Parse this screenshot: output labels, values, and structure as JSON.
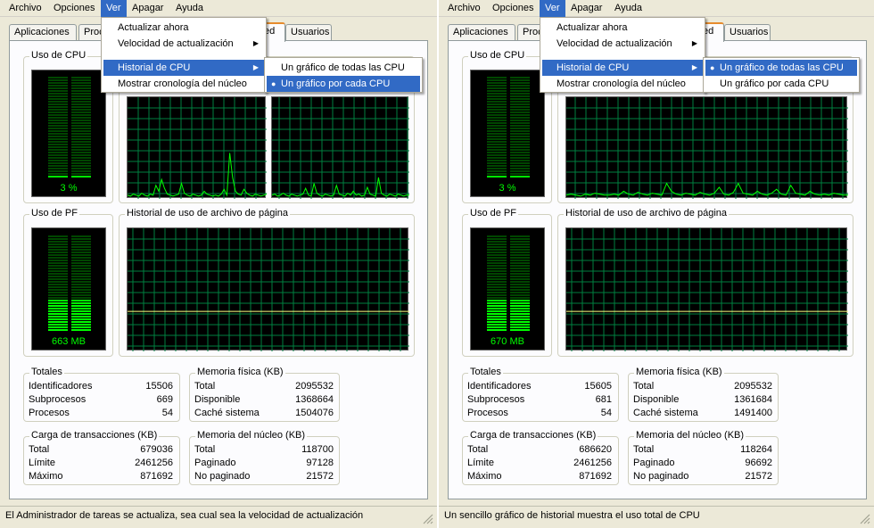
{
  "menubar": [
    "Archivo",
    "Opciones",
    "Ver",
    "Apagar",
    "Ayuda"
  ],
  "tabs": [
    "Aplicaciones",
    "Proc",
    "ed",
    "Usuarios"
  ],
  "view_menu": {
    "items": [
      "Actualizar ahora",
      "Velocidad de actualización",
      "Historial de CPU",
      "Mostrar cronología del núcleo"
    ]
  },
  "cpu_history_submenu": [
    "Un gráfico de todas las CPU",
    "Un gráfico por cada CPU"
  ],
  "labels": {
    "cpu_usage": "Uso de CPU",
    "pf_usage": "Uso de PF",
    "pagefile_history": "Historial de uso de archivo de página",
    "totals": "Totales",
    "physical_memory": "Memoria física (KB)",
    "commit_charge": "Carga de transacciones (KB)",
    "kernel_memory": "Memoria del núcleo (KB)",
    "handles": "Identificadores",
    "threads": "Subprocesos",
    "processes": "Procesos",
    "total": "Total",
    "available": "Disponible",
    "system_cache": "Caché sistema",
    "limit": "Límite",
    "peak": "Máximo",
    "paged": "Paginado",
    "nonpaged": "No paginado"
  },
  "left": {
    "selected_submenu_item": 1,
    "cpu_percent_text": "3 %",
    "cpu_percent": 3,
    "pf_text": "663 MB",
    "pf_fraction": 0.32,
    "totals": {
      "handles": "15506",
      "threads": "669",
      "processes": "54"
    },
    "physical": {
      "total": "2095532",
      "available": "1368664",
      "system_cache": "1504076"
    },
    "commit": {
      "total": "679036",
      "limit": "2461256",
      "peak": "871692"
    },
    "kernel": {
      "total": "118700",
      "paged": "97128",
      "nonpaged": "21572"
    },
    "status": "El Administrador de tareas se actualiza, sea cual sea la velocidad de actualización"
  },
  "right": {
    "selected_submenu_item": 0,
    "cpu_percent_text": "3 %",
    "cpu_percent": 3,
    "pf_text": "670 MB",
    "pf_fraction": 0.32,
    "totals": {
      "handles": "15605",
      "threads": "681",
      "processes": "54"
    },
    "physical": {
      "total": "2095532",
      "available": "1361684",
      "system_cache": "1491400"
    },
    "commit": {
      "total": "686620",
      "limit": "2461256",
      "peak": "871692"
    },
    "kernel": {
      "total": "118264",
      "paged": "96692",
      "nonpaged": "21572"
    },
    "status": "Un sencillo gráfico de historial muestra el uso total de CPU"
  },
  "colors": {
    "graph_bg": "#000000",
    "grid": "#008040",
    "cpu_line": "#00ff00",
    "pf_line": "#ffff80",
    "highlight": "#316ac5"
  },
  "graph_series": {
    "cpu_core0": [
      2,
      1,
      3,
      2,
      1,
      4,
      2,
      1,
      3,
      2,
      12,
      6,
      18,
      9,
      3,
      2,
      1,
      2,
      3,
      14,
      4,
      2,
      1,
      3,
      2,
      1,
      2,
      6,
      3,
      2,
      1,
      2,
      1,
      3,
      8,
      2,
      45,
      20,
      6,
      3,
      2,
      8,
      4,
      2,
      1,
      3,
      2,
      1,
      2,
      3
    ],
    "cpu_core1": [
      2,
      3,
      1,
      2,
      4,
      2,
      1,
      3,
      2,
      1,
      2,
      3,
      9,
      2,
      1,
      14,
      4,
      2,
      1,
      3,
      2,
      1,
      2,
      12,
      3,
      2,
      1,
      4,
      2,
      6,
      2,
      3,
      1,
      2,
      10,
      3,
      2,
      1,
      20,
      4,
      2,
      1,
      3,
      2,
      1,
      3,
      2,
      1,
      2,
      2
    ],
    "cpu_total": [
      2,
      3,
      2,
      1,
      3,
      2,
      4,
      3,
      2,
      2,
      3,
      2,
      6,
      3,
      2,
      5,
      3,
      2,
      4,
      3,
      2,
      14,
      6,
      3,
      2,
      4,
      3,
      2,
      5,
      3,
      2,
      4,
      10,
      3,
      2,
      5,
      14,
      4,
      3,
      2,
      6,
      3,
      2,
      4,
      8,
      3,
      2,
      12,
      4,
      3,
      2,
      6,
      3,
      2,
      3,
      2,
      4,
      3,
      2,
      2
    ],
    "pf_left": [
      32,
      32,
      32,
      32,
      32,
      32,
      32,
      32,
      32,
      32,
      32,
      32,
      32,
      32,
      32,
      32,
      32,
      32,
      32,
      32
    ],
    "pf_right": [
      32,
      32,
      32,
      32,
      32,
      32,
      32,
      32,
      32,
      32,
      32,
      32,
      32,
      32,
      32,
      32,
      32,
      32,
      32,
      32,
      32,
      32,
      32,
      32,
      32,
      32,
      32,
      32,
      32,
      32
    ]
  }
}
